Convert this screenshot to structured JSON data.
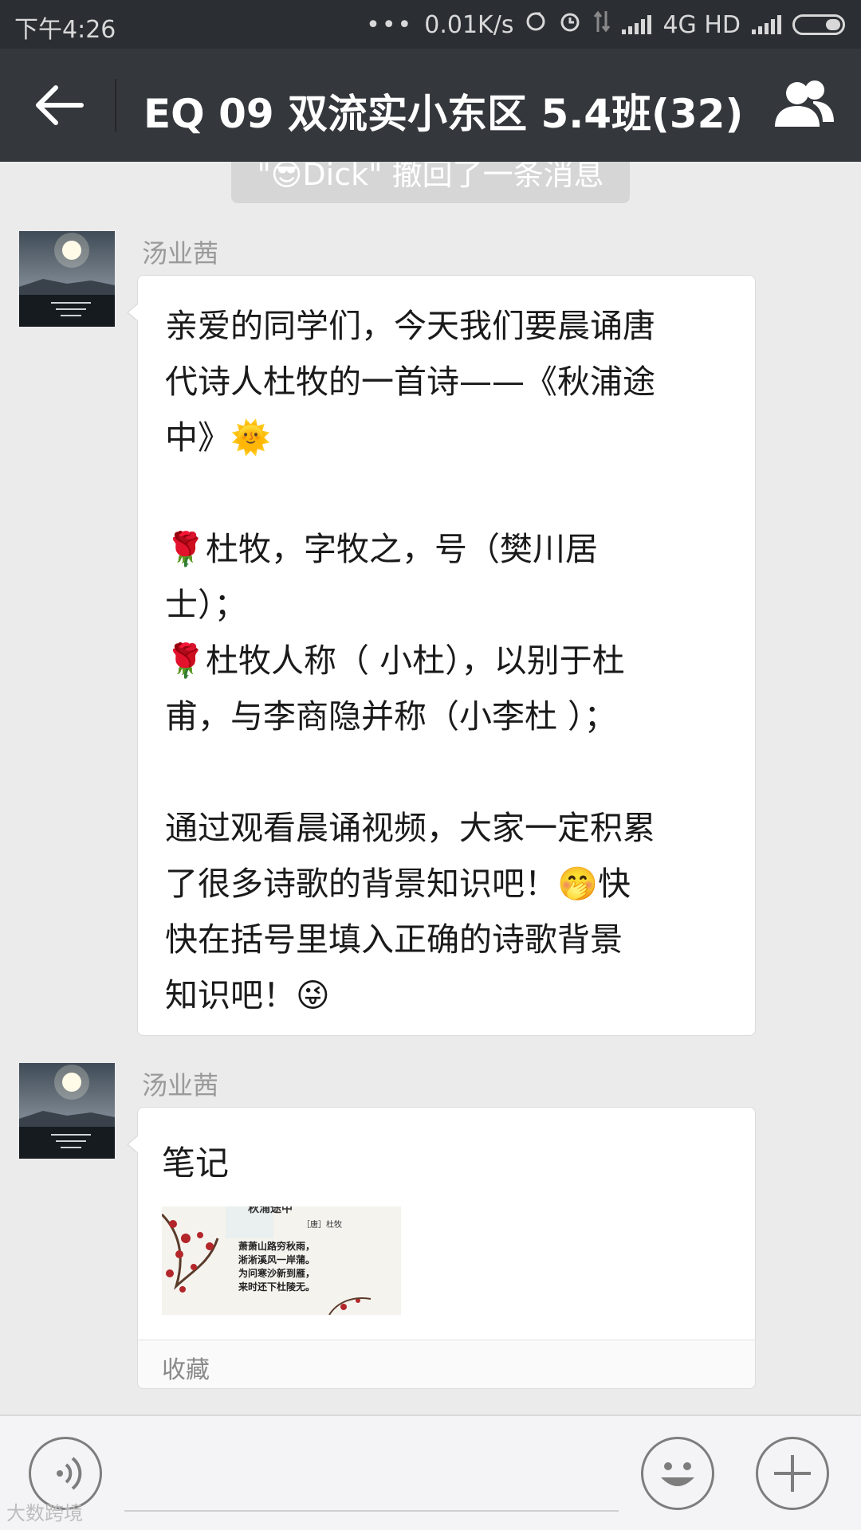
{
  "status_bar": {
    "time": "下午4:26",
    "network_speed": "0.01K/s",
    "network_type": "4G HD",
    "icons": [
      "dots-icon",
      "sync-icon",
      "alarm-icon",
      "data-arrows-icon",
      "signal-icon",
      "signal-icon",
      "battery-icon"
    ]
  },
  "nav": {
    "title": "EQ 09 双流实小东区 5.4班(32)",
    "back_icon": "back-arrow-icon",
    "members_icon": "group-members-icon"
  },
  "chat": {
    "recall_notice": "\"😎Dick\" 撤回了一条消息",
    "messages": [
      {
        "sender": "汤业茜",
        "lines": [
          "亲爱的同学们，今天我们要晨诵唐",
          "代诗人杜牧的一首诗——《秋浦途",
          "中》🌞",
          "",
          "🌹杜牧，字牧之，号（樊川居",
          "士）；",
          "🌹杜牧人称（ 小杜），以别于杜",
          "甫，与李商隐并称（小李杜 ）；",
          "",
          "通过观看晨诵视频，大家一定积累",
          "了很多诗歌的背景知识吧！🤭快",
          "快在括号里填入正确的诗歌背景",
          "知识吧！😜"
        ]
      },
      {
        "sender": "汤业茜",
        "note_title": "笔记",
        "note_image": {
          "heading": "秋浦途中",
          "author": "［唐］杜牧",
          "poem": [
            "萧萧山路穷秋雨，",
            "淅淅溪风一岸蒲。",
            "为问寒沙新到雁，",
            "来时还下杜陵无。"
          ]
        },
        "note_footer": "收藏"
      }
    ]
  },
  "input_bar": {
    "voice_icon": "voice-icon",
    "emoji_icon": "emoji-icon",
    "plus_icon": "plus-icon"
  },
  "watermark": "大数跨境",
  "colors": {
    "status_bar": "#2b2e33",
    "nav_bar": "#34373c",
    "chat_bg": "#ebebeb",
    "bubble": "#ffffff"
  }
}
